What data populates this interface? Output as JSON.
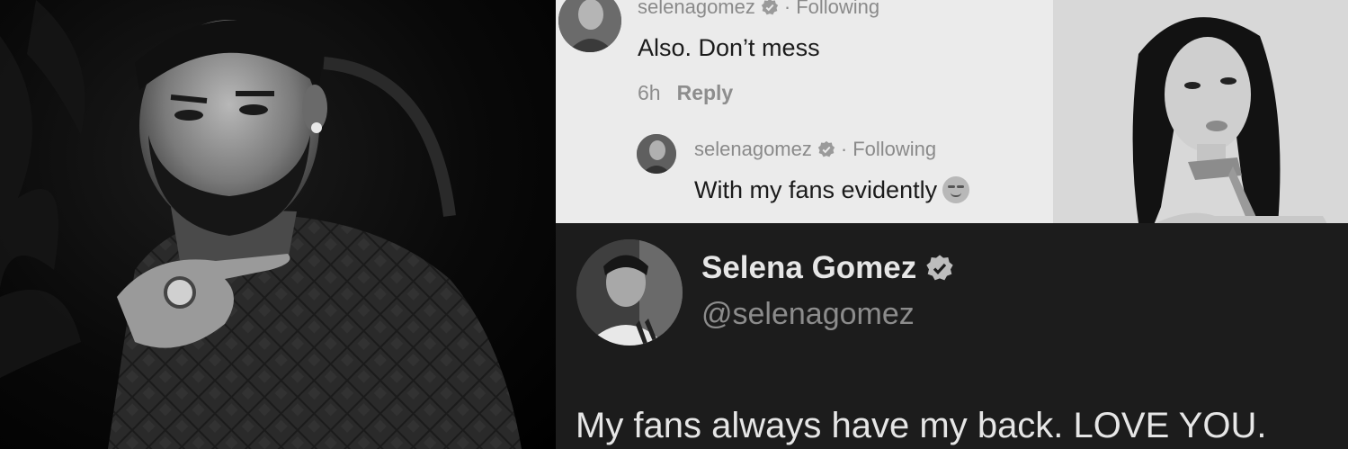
{
  "instagram_comments": {
    "comment": {
      "username": "selenagomez",
      "separator": "·",
      "following_label": "Following",
      "text": "Also. Don’t mess",
      "time": "6h",
      "reply_label": "Reply"
    },
    "reply": {
      "username": "selenagomez",
      "separator": "·",
      "following_label": "Following",
      "text": "With my fans evidently",
      "emoji": "smirking-face-emoji"
    }
  },
  "twitter_post": {
    "display_name": "Selena Gomez",
    "handle": "@selenagomez",
    "tweet_text": "My fans always have my back. LOVE YOU."
  },
  "colors": {
    "verified_badge_light": "#9a9a9a",
    "verified_badge_dark": "#bdbdbd"
  }
}
